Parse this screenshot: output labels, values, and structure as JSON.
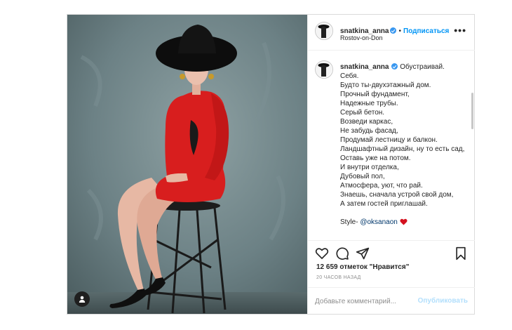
{
  "header": {
    "username": "snatkina_anna",
    "separator": "•",
    "follow_label": "Подписаться",
    "location": "Rostov-on-Don",
    "more_label": "•••"
  },
  "caption": {
    "username": "snatkina_anna",
    "text": "Обустраивай.\nСебя.\nБудто ты-двухэтажный дом.\nПрочный фундамент,\nНадежные трубы.\nСерый бетон.\nВозведи каркас,\nНе забудь фасад,\nПродумай лестницу и балкон.\nЛандшафтный дизайн, ну то есть сад,\nОставь уже на потом.\nИ внутри отделка,\nДубовый пол,\nАтмосфера, уют, что рай.\nЗнаешь, сначала устрой свой дом,\nА затем гостей приглашай.",
    "style_prefix": "Style- ",
    "style_mention": "@oksanaon"
  },
  "stats": {
    "likes": "12 659 отметок \"Нравится\"",
    "time": "20 ЧАСОВ НАЗАД"
  },
  "comment_box": {
    "placeholder": "Добавьте комментарий...",
    "publish_label": "Опубликовать"
  },
  "icons": [
    "tag-user-icon",
    "heart-icon",
    "comment-icon",
    "share-icon",
    "bookmark-icon",
    "verified-icon",
    "red-heart-icon"
  ],
  "colors": {
    "accent": "#0095f6",
    "verified": "#3897f0",
    "dress": "#d81e1e",
    "wall": "#6f8589"
  }
}
